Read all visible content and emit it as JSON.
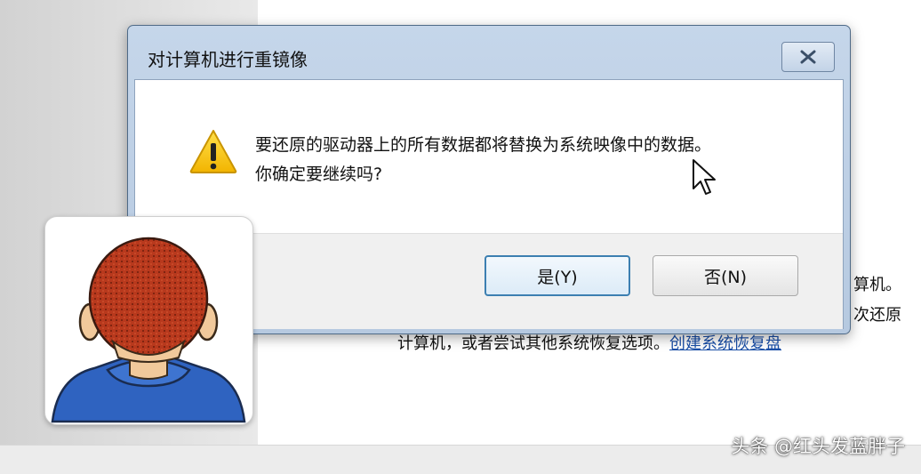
{
  "dialog": {
    "title": "对计算机进行重镜像",
    "message_line1": "要还原的驱动器上的所有数据都将替换为系统映像中的数据。",
    "message_line2": "你确定要继续吗?",
    "yes_label": "是(Y)",
    "no_label": "否(N)",
    "close_icon": "close-icon",
    "warning_icon": "warning-icon"
  },
  "background": {
    "text_fragment_1": "算机。",
    "text_fragment_2": "次还原",
    "text_line3": "计算机，或者尝试其他系统恢复选项。",
    "link_text": "创建系统恢复盘"
  },
  "watermark": "头条 @红头发蓝胖子",
  "colors": {
    "dialog_frame": "#b6c9e0",
    "warning_yellow": "#f5c000",
    "default_button_border": "#3c7fb1",
    "link": "#1a4fa8",
    "hair": "#b43a20",
    "shirt": "#2f63c0"
  }
}
